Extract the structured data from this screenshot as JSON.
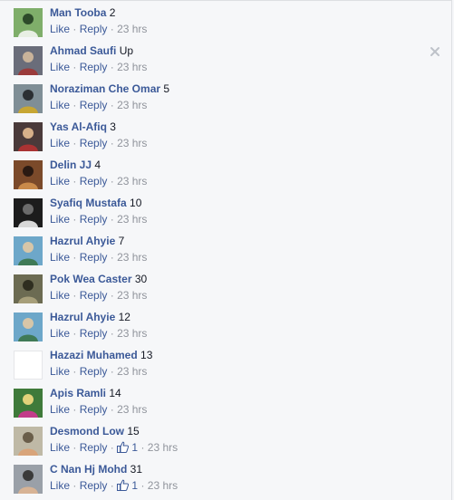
{
  "comments": [
    {
      "author": "Man Tooba",
      "text": "2",
      "like_label": "Like",
      "reply_label": "Reply",
      "separator": "·",
      "time": "23 hrs",
      "likes": null,
      "avatar_colors": [
        "#7fae6a",
        "#e8efe4",
        "#2d4a2a"
      ]
    },
    {
      "author": "Ahmad Saufi",
      "text": "Up",
      "like_label": "Like",
      "reply_label": "Reply",
      "separator": "·",
      "time": "23 hrs",
      "likes": null,
      "avatar_colors": [
        "#6a6d7a",
        "#9a3b3b",
        "#c9b39a"
      ]
    },
    {
      "author": "Noraziman Che Omar",
      "text": "5",
      "like_label": "Like",
      "reply_label": "Reply",
      "separator": "·",
      "time": "23 hrs",
      "likes": null,
      "avatar_colors": [
        "#7f8e96",
        "#c7a634",
        "#2b2f33"
      ]
    },
    {
      "author": "Yas Al-Afiq",
      "text": "3",
      "like_label": "Like",
      "reply_label": "Reply",
      "separator": "·",
      "time": "23 hrs",
      "likes": null,
      "avatar_colors": [
        "#4a3a3a",
        "#a33",
        "#d6b08a"
      ]
    },
    {
      "author": "Delin JJ",
      "text": "4",
      "like_label": "Like",
      "reply_label": "Reply",
      "separator": "·",
      "time": "23 hrs",
      "likes": null,
      "avatar_colors": [
        "#7b4a2a",
        "#c98a4a",
        "#2a1a12"
      ]
    },
    {
      "author": "Syafiq Mustafa",
      "text": "10",
      "like_label": "Like",
      "reply_label": "Reply",
      "separator": "·",
      "time": "23 hrs",
      "likes": null,
      "avatar_colors": [
        "#1c1c1c",
        "#d8d8d8",
        "#6b6b6b"
      ]
    },
    {
      "author": "Hazrul Ahyie",
      "text": "7",
      "like_label": "Like",
      "reply_label": "Reply",
      "separator": "·",
      "time": "23 hrs",
      "likes": null,
      "avatar_colors": [
        "#6da7c9",
        "#3f7a56",
        "#d7c6a8"
      ]
    },
    {
      "author": "Pok Wea Caster",
      "text": "30",
      "like_label": "Like",
      "reply_label": "Reply",
      "separator": "·",
      "time": "23 hrs",
      "likes": null,
      "avatar_colors": [
        "#6c6b52",
        "#a79f7a",
        "#2f2e20"
      ]
    },
    {
      "author": "Hazrul Ahyie",
      "text": "12",
      "like_label": "Like",
      "reply_label": "Reply",
      "separator": "·",
      "time": "23 hrs",
      "likes": null,
      "avatar_colors": [
        "#6da7c9",
        "#3f7a56",
        "#d7c6a8"
      ]
    },
    {
      "author": "Hazazi Muhamed",
      "text": "13",
      "like_label": "Like",
      "reply_label": "Reply",
      "separator": "·",
      "time": "23 hrs",
      "likes": null,
      "avatar_colors": [
        "#ffffff",
        "#ffffff",
        "#ffffff"
      ]
    },
    {
      "author": "Apis Ramli",
      "text": "14",
      "like_label": "Like",
      "reply_label": "Reply",
      "separator": "·",
      "time": "23 hrs",
      "likes": null,
      "avatar_colors": [
        "#3f7a3a",
        "#c23b8a",
        "#e3d27a"
      ]
    },
    {
      "author": "Desmond Low",
      "text": "15",
      "like_label": "Like",
      "reply_label": "Reply",
      "separator": "·",
      "time": "23 hrs",
      "likes": "1",
      "avatar_colors": [
        "#bfb9a6",
        "#d8a47a",
        "#6a5e4a"
      ]
    },
    {
      "author": "C Nan Hj Mohd",
      "text": "31",
      "like_label": "Like",
      "reply_label": "Reply",
      "separator": "·",
      "time": "23 hrs",
      "likes": "1",
      "avatar_colors": [
        "#9aa0a8",
        "#d7b395",
        "#3a3a3a"
      ]
    }
  ],
  "colors": {
    "link": "#3b5998",
    "meta": "#90949c",
    "background": "#f6f7f9"
  },
  "icons": {
    "close": "close-icon",
    "like": "thumbs-up-icon"
  }
}
